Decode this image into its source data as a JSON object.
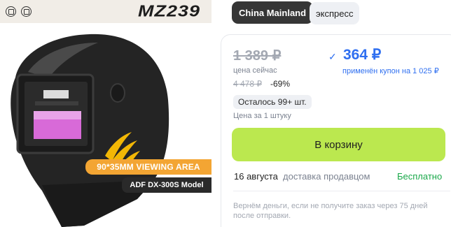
{
  "product_image": {
    "model_name": "MZ239",
    "banner_area": "90*35MM VIEWING AREA",
    "banner_model": "ADF DX-300S Model",
    "badges": [
      "certification-badge-icon",
      "certification-badge-icon"
    ],
    "colors": {
      "helmet": "#222222",
      "accent_stripe": "#f2b705",
      "lens": "#d86ad8",
      "banner": "#f3a533"
    }
  },
  "chips": {
    "region": "China Mainland",
    "delivery_type": "экспресс"
  },
  "pricing": {
    "old_price": "1 389 ₽",
    "now_label": "цена сейчас",
    "original_price": "4 478 ₽",
    "discount": "-69%",
    "stock": "Осталось 99+ шт.",
    "unit_price_label": "Цена за 1 штуку",
    "check_icon": "✓",
    "coupon_price": "364 ₽",
    "coupon_note": "применён купон на 1 025 ₽",
    "colors": {
      "coupon": "#2f6ff0",
      "cart_button": "#bbe84f",
      "free": "#1aa84a"
    }
  },
  "cart": {
    "button_label": "В корзину"
  },
  "delivery": {
    "date": "16 августа",
    "by": "доставка продавцом",
    "cost": "Бесплатно"
  },
  "refund": {
    "note": "Вернём деньги, если не получите заказ через 75 дней после отправки."
  }
}
